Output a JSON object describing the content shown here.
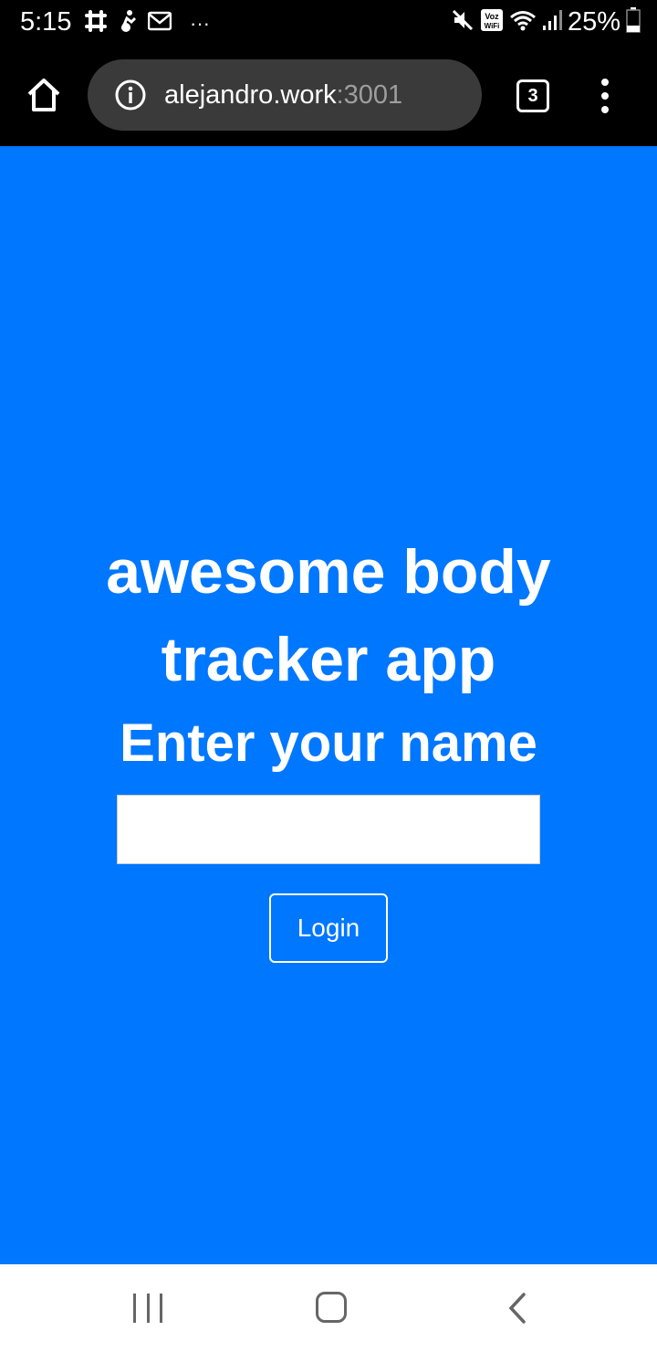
{
  "status_bar": {
    "time": "5:15",
    "more_indicator": "···",
    "battery": "25%"
  },
  "browser": {
    "url_host": "alejandro.work",
    "url_port": ":3001",
    "tab_count": "3"
  },
  "page": {
    "title": "awesome body tracker app",
    "subtitle": "Enter your name",
    "name_input_value": "",
    "login_label": "Login"
  },
  "colors": {
    "background": "#0077ff",
    "bars": "#000000",
    "nav": "#ffffff"
  }
}
